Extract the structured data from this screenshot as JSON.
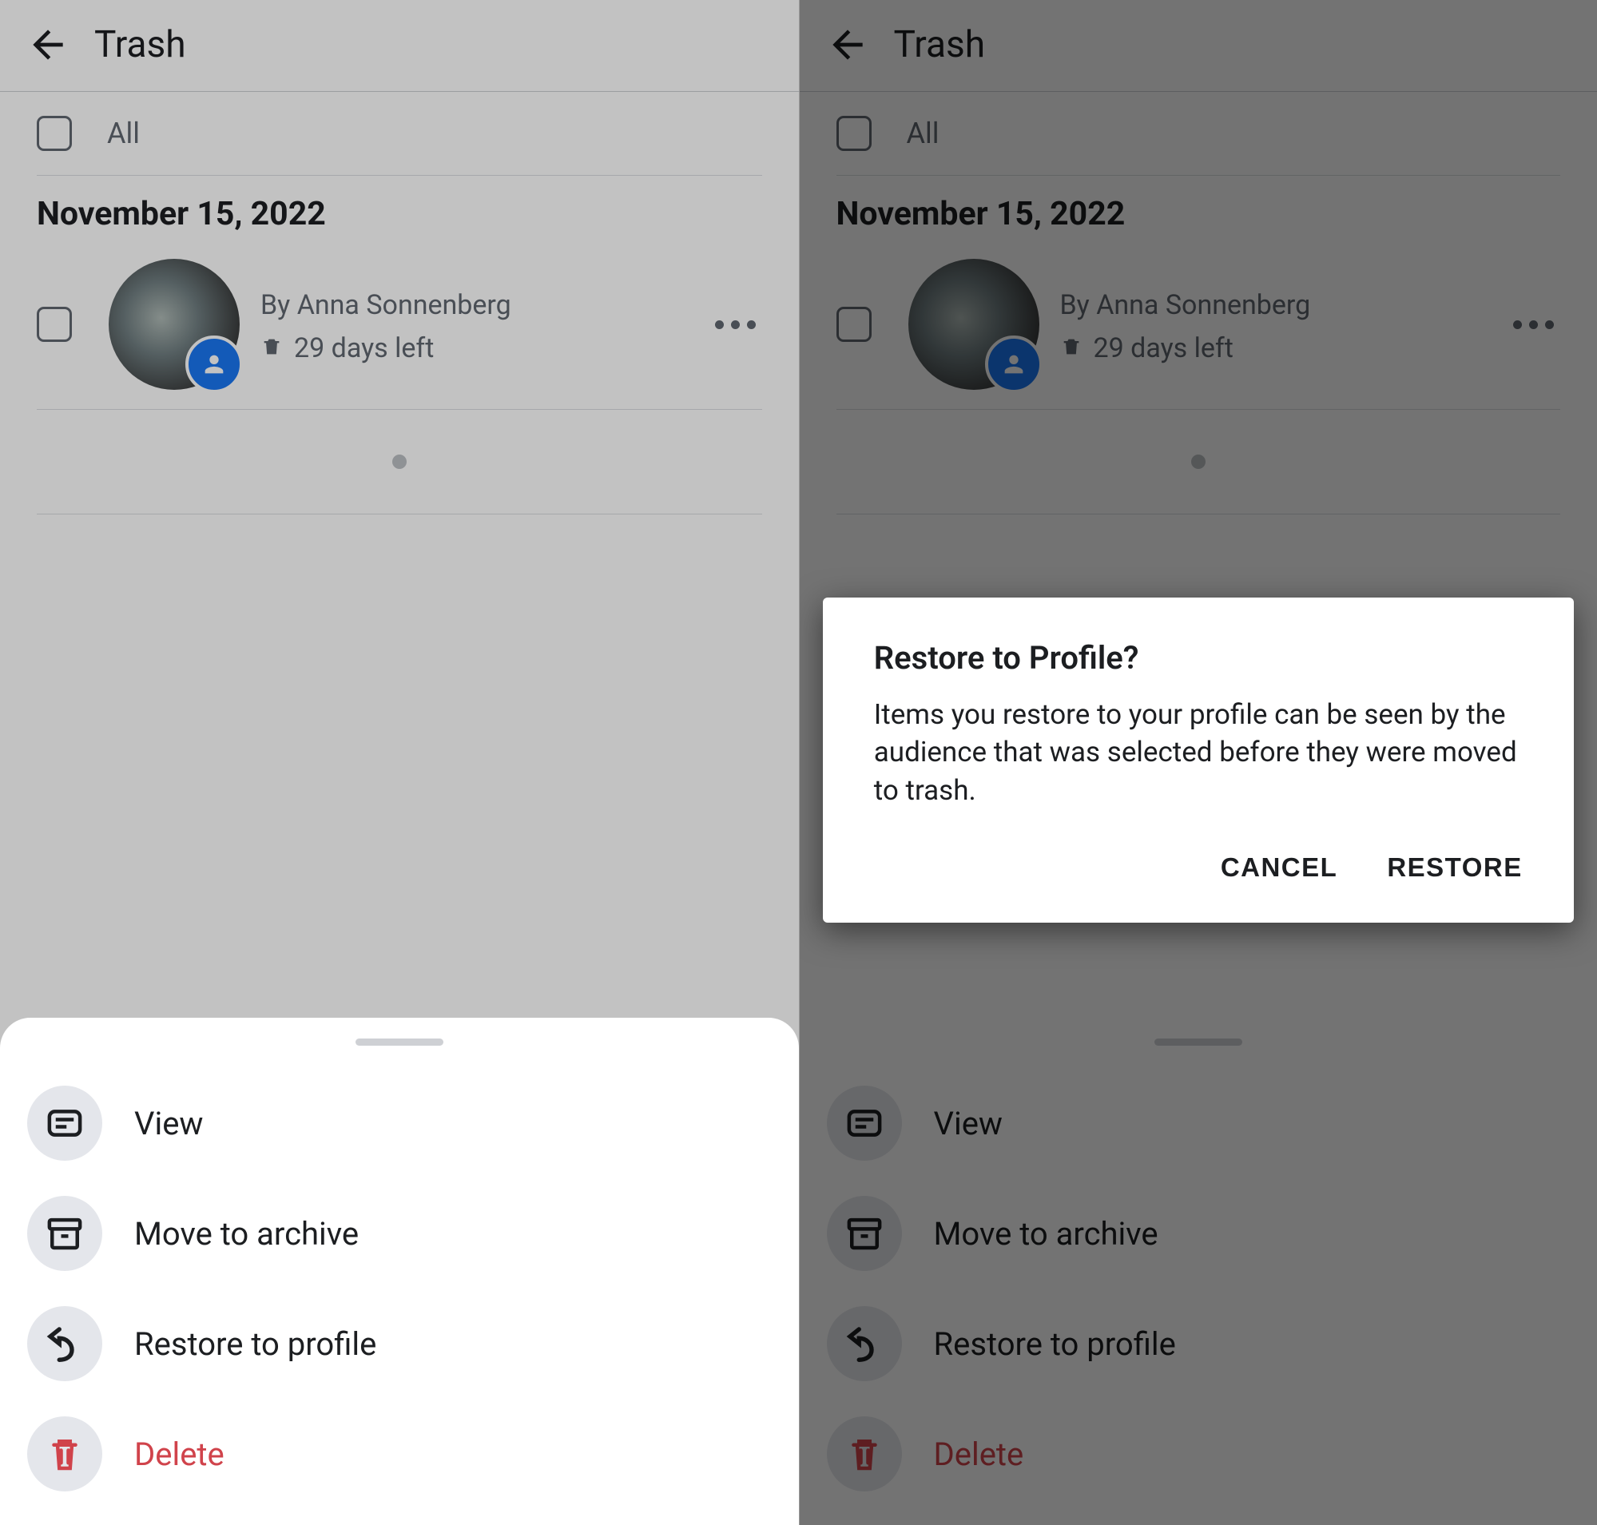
{
  "header": {
    "title": "Trash"
  },
  "all": {
    "label": "All"
  },
  "date_header": "November 15, 2022",
  "item": {
    "byline": "By Anna Sonnenberg",
    "days_left": "29 days left"
  },
  "sheet": {
    "view": "View",
    "archive": "Move to archive",
    "restore": "Restore to profile",
    "delete": "Delete"
  },
  "dialog": {
    "title": "Restore to Profile?",
    "body": "Items you restore to your profile can be seen by the audience that was selected before they were moved to trash.",
    "cancel": "CANCEL",
    "restore": "RESTORE"
  }
}
